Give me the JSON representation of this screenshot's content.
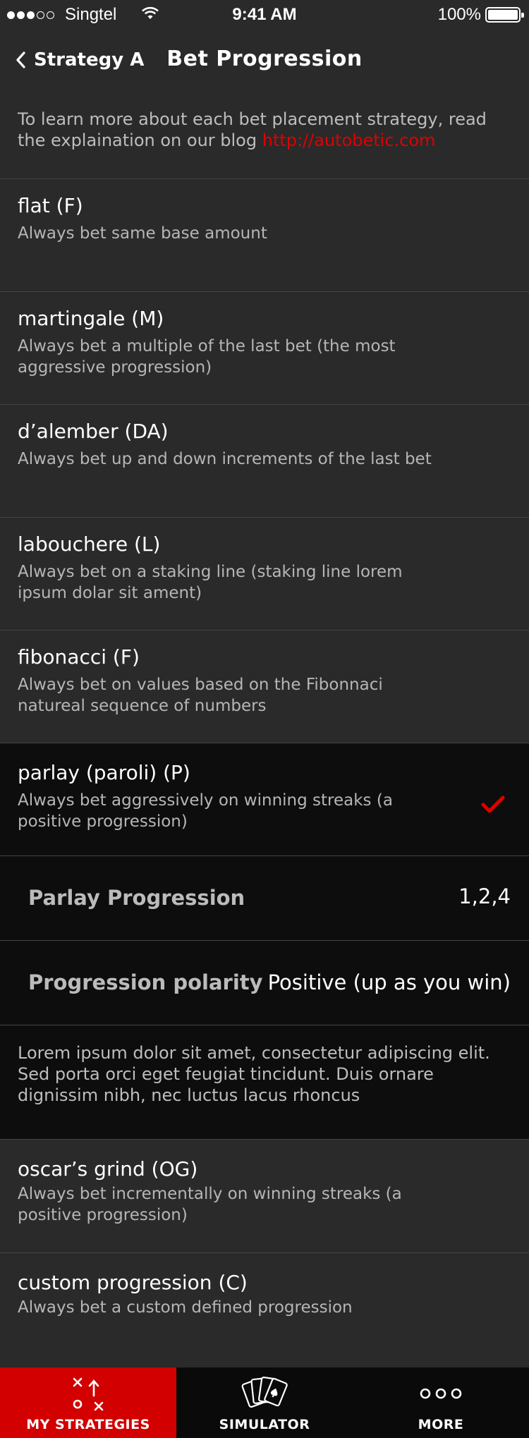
{
  "status": {
    "carrier": "Singtel",
    "time": "9:41 AM",
    "battery": "100%"
  },
  "nav": {
    "back_label": "Strategy A",
    "title": "Bet Progression"
  },
  "intro": {
    "text": "To learn more about each bet placement strategy, read the explaination on our blog ",
    "link": "http://autobetic.com"
  },
  "strategies": [
    {
      "title": "flat (F)",
      "desc": "Always bet same base amount"
    },
    {
      "title": "martingale (M)",
      "desc": "Always bet a multiple of the last bet (the most aggressive progression)"
    },
    {
      "title": "d’alember (DA)",
      "desc": "Always bet up and down increments of the last bet"
    },
    {
      "title": "labouchere (L)",
      "desc": "Always bet on a staking line (staking line lorem ipsum dolar sit ament)"
    },
    {
      "title": "fibonacci (F)",
      "desc": "Always bet on values based on the Fibonnaci natureal sequence of numbers"
    },
    {
      "title": "parlay (paroli) (P)",
      "desc": "Always bet aggressively on winning streaks (a positive progression)",
      "selected": true
    },
    {
      "title": "oscar’s grind (OG)",
      "desc": "Always bet incrementally on winning streaks (a positive progression)"
    },
    {
      "title": "custom progression (C)",
      "desc": "Always bet a custom defined progression"
    }
  ],
  "parlay_settings": {
    "progression_label": "Parlay Progression",
    "progression_value": "1,2,4",
    "polarity_label": "Progression polarity",
    "polarity_value": "Positive (up as you win)",
    "note": "Lorem ipsum dolor sit amet, consectetur adipiscing elit. Sed porta orci eget feugiat tincidunt. Duis ornare dignissim nibh, nec luctus lacus rhoncus"
  },
  "tabs": [
    {
      "label": "MY STRATEGIES",
      "icon": "strategy-play-icon",
      "active": true
    },
    {
      "label": "SIMULATOR",
      "icon": "playing-cards-icon",
      "active": false
    },
    {
      "label": "MORE",
      "icon": "more-dots-icon",
      "active": false
    }
  ],
  "colors": {
    "accent": "#d20000",
    "background": "#2a2a2a",
    "selected_background": "#0d0d0d",
    "link": "#e00000"
  }
}
